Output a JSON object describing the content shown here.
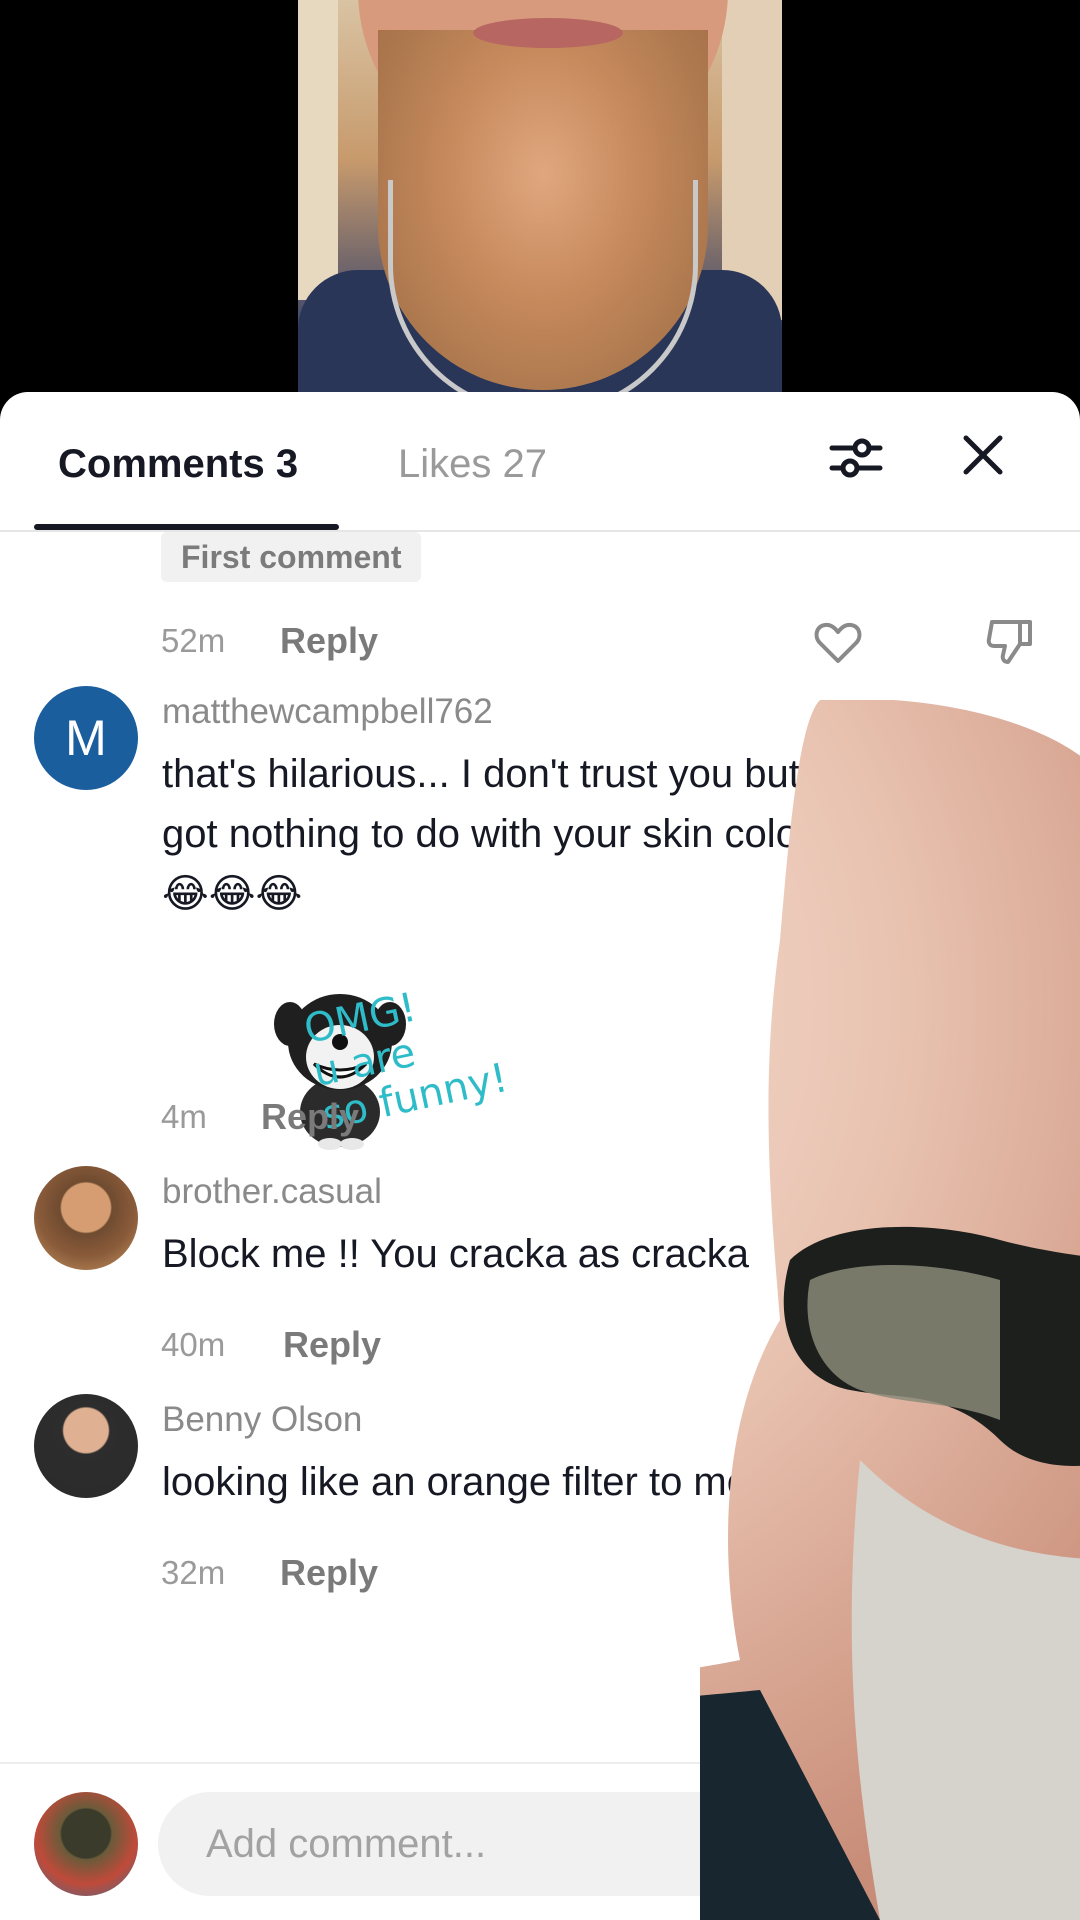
{
  "tabs": {
    "comments_label": "Comments 3",
    "likes_label": "Likes 27"
  },
  "icons": {
    "filter": "filter-sliders-icon",
    "close": "close-icon",
    "like": "heart-outline-icon",
    "dislike": "thumbs-down-icon"
  },
  "first_thread": {
    "tag": "First comment",
    "time": "52m",
    "reply_label": "Reply"
  },
  "comments": [
    {
      "avatar_letter": "M",
      "username": "matthewcampbell762",
      "text_line1": "that's hilarious... I don't trust you but it's",
      "text_line2": "got nothing to do with your skin color 😂",
      "text_line3": "😂😂😂",
      "sticker_text_1": "OMG!",
      "sticker_text_2": "u are",
      "sticker_text_3": "so funny!",
      "time": "4m",
      "reply_label": "Reply"
    },
    {
      "username": "brother.casual",
      "text": "Block me !! You cracka as cracka",
      "time": "40m",
      "reply_label": "Reply"
    },
    {
      "username": "Benny Olson",
      "text": "looking like an orange filter to me",
      "time": "32m",
      "reply_label": "Reply"
    }
  ],
  "composer": {
    "placeholder": "Add comment..."
  }
}
